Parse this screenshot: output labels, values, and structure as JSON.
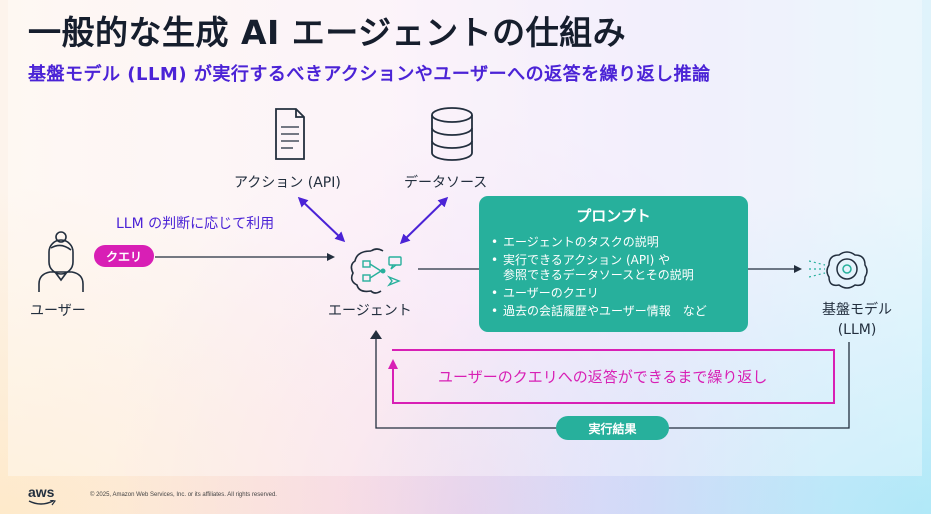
{
  "title": "一般的な生成 AI エージェントの仕組み",
  "subtitle": "基盤モデル (LLM) が実行するべきアクションやユーザーへの返答を繰り返し推論",
  "nodes": {
    "action_label": "アクション (API)",
    "datasource_label": "データソース",
    "agent_label": "エージェント",
    "user_label": "ユーザー",
    "model_label_line1": "基盤モデル",
    "model_label_line2": "(LLM)"
  },
  "edges": {
    "llm_decision_label": "LLM の判断に応じて利用",
    "query_label": "クエリ",
    "result_label": "実行結果"
  },
  "prompt": {
    "title": "プロンプト",
    "items": [
      "エージェントのタスクの説明",
      "実行できるアクション (API) や",
      "参照できるデータソースとその説明",
      "ユーザーのクエリ",
      "過去の会話履歴やユーザー情報　など"
    ]
  },
  "loop_text": "ユーザーのクエリへの返答ができるまで繰り返し",
  "footer": {
    "logo": "aws",
    "copyright": "© 2025, Amazon Web Services, Inc. or its affiliates. All rights reserved."
  },
  "colors": {
    "accent_purple": "#4b23d6",
    "accent_magenta": "#d81fb5",
    "teal": "#27b09c",
    "dark": "#232f3e"
  },
  "icons": [
    "document-icon",
    "database-icon",
    "agent-icon",
    "user-icon",
    "model-icon"
  ]
}
